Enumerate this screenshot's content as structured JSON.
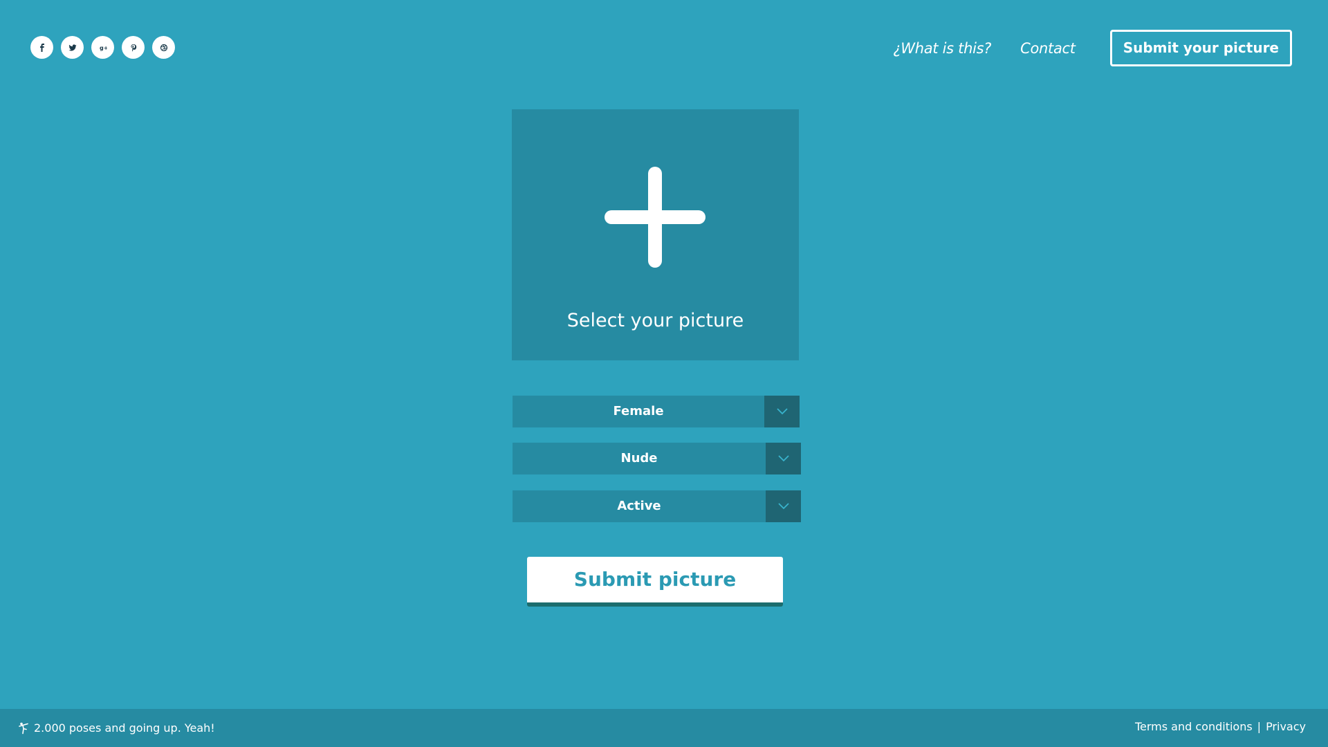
{
  "header": {
    "social": [
      {
        "icon": "facebook-icon",
        "glyph": "f"
      },
      {
        "icon": "twitter-icon",
        "glyph": "t"
      },
      {
        "icon": "google-plus-icon",
        "glyph": "g+"
      },
      {
        "icon": "pinterest-icon",
        "glyph": "p"
      },
      {
        "icon": "dribbble-icon",
        "glyph": "d"
      }
    ],
    "nav": {
      "what_label": "¿What is this?",
      "contact_label": "Contact",
      "submit_label": "Submit your picture"
    }
  },
  "upload": {
    "label": "Select your picture"
  },
  "form": {
    "gender": {
      "value": "Female"
    },
    "clothing": {
      "value": "Nude"
    },
    "pose_type": {
      "value": "Active"
    },
    "submit_label": "Submit picture"
  },
  "footer": {
    "count_text": "2.000 poses and going up. Yeah!",
    "terms_label": "Terms and conditions",
    "separator": "|",
    "privacy_label": "Privacy"
  },
  "colors": {
    "background": "#2ea3bd",
    "panel": "#268ba2",
    "select_arrow_bg": "#1f6573",
    "submit_text": "#2b9ab3",
    "submit_shadow": "#1c6d6e"
  }
}
